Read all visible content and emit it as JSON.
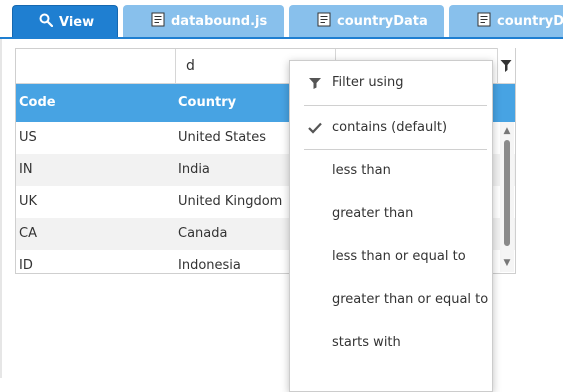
{
  "tabs": [
    {
      "label": "View",
      "icon": "search-icon",
      "active": true
    },
    {
      "label": "databound.js",
      "icon": "file-code-icon",
      "active": false
    },
    {
      "label": "countryData",
      "icon": "file-code-icon",
      "active": false
    },
    {
      "label": "countryDS",
      "icon": "file-code-icon",
      "active": false
    }
  ],
  "grid": {
    "filter_values": [
      "",
      "d",
      ""
    ],
    "headers": [
      "Code",
      "Country"
    ],
    "rows": [
      [
        "US",
        "United States"
      ],
      [
        "IN",
        "India"
      ],
      [
        "UK",
        "United Kingdom"
      ],
      [
        "CA",
        "Canada"
      ],
      [
        "ID",
        "Indonesia"
      ]
    ]
  },
  "filter_menu": {
    "title": "Filter using",
    "options": [
      {
        "label": "contains (default)",
        "checked": true
      },
      {
        "label": "less than",
        "checked": false
      },
      {
        "label": "greater than",
        "checked": false
      },
      {
        "label": "less than or equal to",
        "checked": false
      },
      {
        "label": "greater than or equal to",
        "checked": false
      },
      {
        "label": "starts with",
        "checked": false
      }
    ]
  },
  "colors": {
    "tab_active": "#1f7fd1",
    "tab_inactive": "#88c0ec",
    "header_bg": "#47a3e3",
    "row_alt": "#f2f2f2"
  }
}
